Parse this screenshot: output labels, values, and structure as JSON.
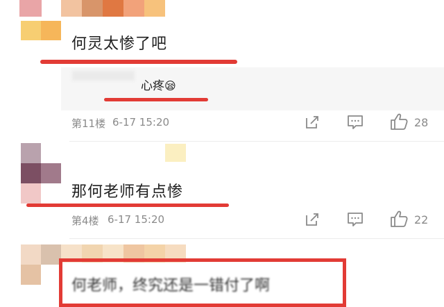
{
  "comments": [
    {
      "text": "何灵太惨了吧",
      "reply": {
        "text": "心疼",
        "emoji": "😪"
      },
      "floor": "第11楼",
      "time": "6-17 15:20",
      "likes": "28"
    },
    {
      "text": "那何老师有点惨",
      "floor": "第4楼",
      "time": "6-17 15:20",
      "likes": "22"
    },
    {
      "text": "何老师，终究还是一错付了啊"
    }
  ],
  "colors": {
    "highlight_red": "#e23b35",
    "meta_gray": "#8a8a8a"
  },
  "icons": [
    "share-icon",
    "comment-icon",
    "thumbs-up-icon"
  ]
}
